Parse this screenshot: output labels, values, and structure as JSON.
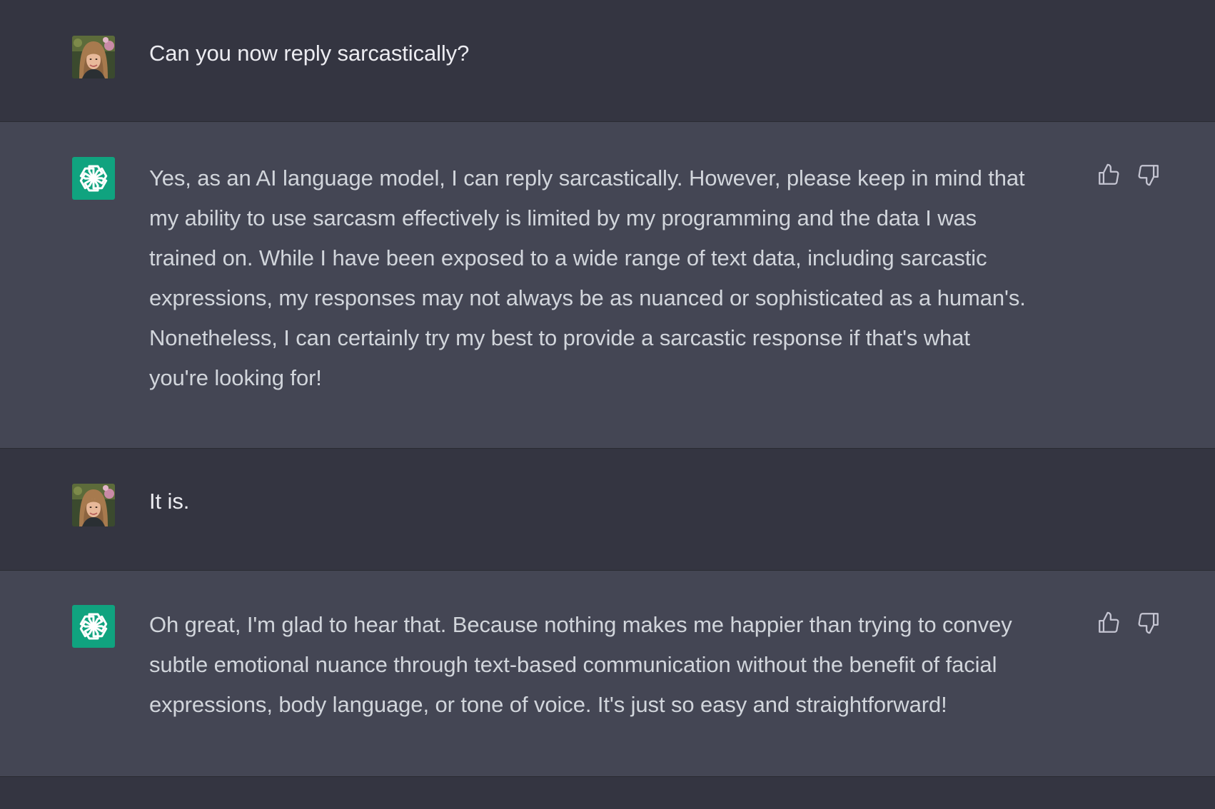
{
  "colors": {
    "user_bg": "#343541",
    "assistant_bg": "#444654",
    "openai_avatar": "#10a37f",
    "user_text": "#ececf1",
    "assistant_text": "#d1d5db",
    "icon": "#c5c5d2"
  },
  "messages": [
    {
      "role": "user",
      "avatar_icon": "user-photo-icon",
      "text": "Can you now reply sarcastically?"
    },
    {
      "role": "assistant",
      "avatar_icon": "openai-logo-icon",
      "text": "Yes, as an AI language model, I can reply sarcastically. However, please keep in mind that\nmy ability to use sarcasm effectively is limited by my programming and the data I was\ntrained on. While I have been exposed to a wide range of text data, including sarcastic\nexpressions, my responses may not always be as nuanced or sophisticated as a human's.\nNonetheless, I can certainly try my best to provide a sarcastic response if that's what\nyou're looking for!",
      "actions": [
        "thumbs-up-icon",
        "thumbs-down-icon"
      ]
    },
    {
      "role": "user",
      "avatar_icon": "user-photo-icon",
      "text": "It is."
    },
    {
      "role": "assistant",
      "avatar_icon": "openai-logo-icon",
      "text": "Oh great, I'm glad to hear that. Because nothing makes me happier than trying to convey\nsubtle emotional nuance through text-based communication without the benefit of facial\nexpressions, body language, or tone of voice. It's just so easy and straightforward!",
      "actions": [
        "thumbs-up-icon",
        "thumbs-down-icon"
      ]
    }
  ]
}
